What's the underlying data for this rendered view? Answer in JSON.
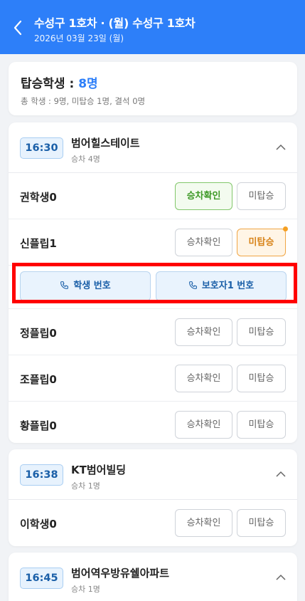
{
  "header": {
    "title": "수성구 1호차 · (월) 수성구 1호차",
    "date": "2026년 03월 23일 (월)"
  },
  "summary": {
    "label": "탑승학생 : ",
    "count": "8명",
    "sub": "총 학생 : 9명, 미탑승 1명, 결석 0명"
  },
  "buttons": {
    "board": "승차확인",
    "miss": "미탑승",
    "student_phone": "학생 번호",
    "parent_phone": "보호자1 번호"
  },
  "stops": [
    {
      "time": "16:30",
      "name": "범어힐스테이트",
      "sub": "승차 4명",
      "students": [
        {
          "name": "권학생0",
          "status": "boarded"
        },
        {
          "name": "신플립1",
          "status": "missed"
        },
        {
          "name": "정플립0",
          "status": "none"
        },
        {
          "name": "조플립0",
          "status": "none"
        },
        {
          "name": "황플립0",
          "status": "none"
        }
      ]
    },
    {
      "time": "16:38",
      "name": "KT범어빌딩",
      "sub": "승차 1명",
      "students": [
        {
          "name": "이학생0",
          "status": "none"
        }
      ]
    },
    {
      "time": "16:45",
      "name": "범어역우방유쉘아파트",
      "sub": "승차 1명",
      "students": []
    }
  ],
  "colors": {
    "header": "#2d7ff9",
    "boarded": "#3f9a28",
    "missed": "#d8841a",
    "highlight": "#ff0000"
  }
}
